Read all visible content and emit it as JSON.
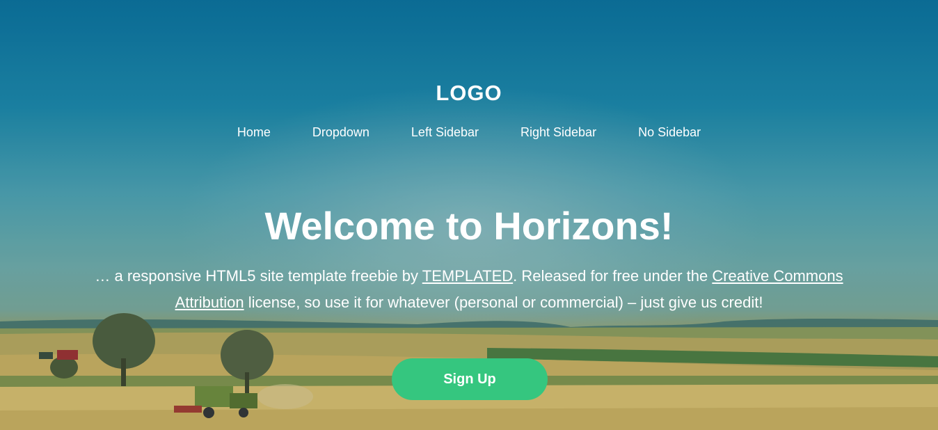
{
  "header": {
    "logo": "LOGO"
  },
  "nav": {
    "items": [
      {
        "label": "Home"
      },
      {
        "label": "Dropdown"
      },
      {
        "label": "Left Sidebar"
      },
      {
        "label": "Right Sidebar"
      },
      {
        "label": "No Sidebar"
      }
    ]
  },
  "banner": {
    "title": "Welcome to Horizons!",
    "desc_part1": "… a responsive HTML5 site template freebie by ",
    "link_templated": "TEMPLATED",
    "desc_part2": ". Released for free under the ",
    "link_license": "Creative Commons Attribution",
    "desc_part3": " license, so use it for whatever (personal or commercial) – just give us credit!",
    "button_label": "Sign Up"
  },
  "colors": {
    "accent": "#35c67f",
    "text": "#ffffff"
  }
}
